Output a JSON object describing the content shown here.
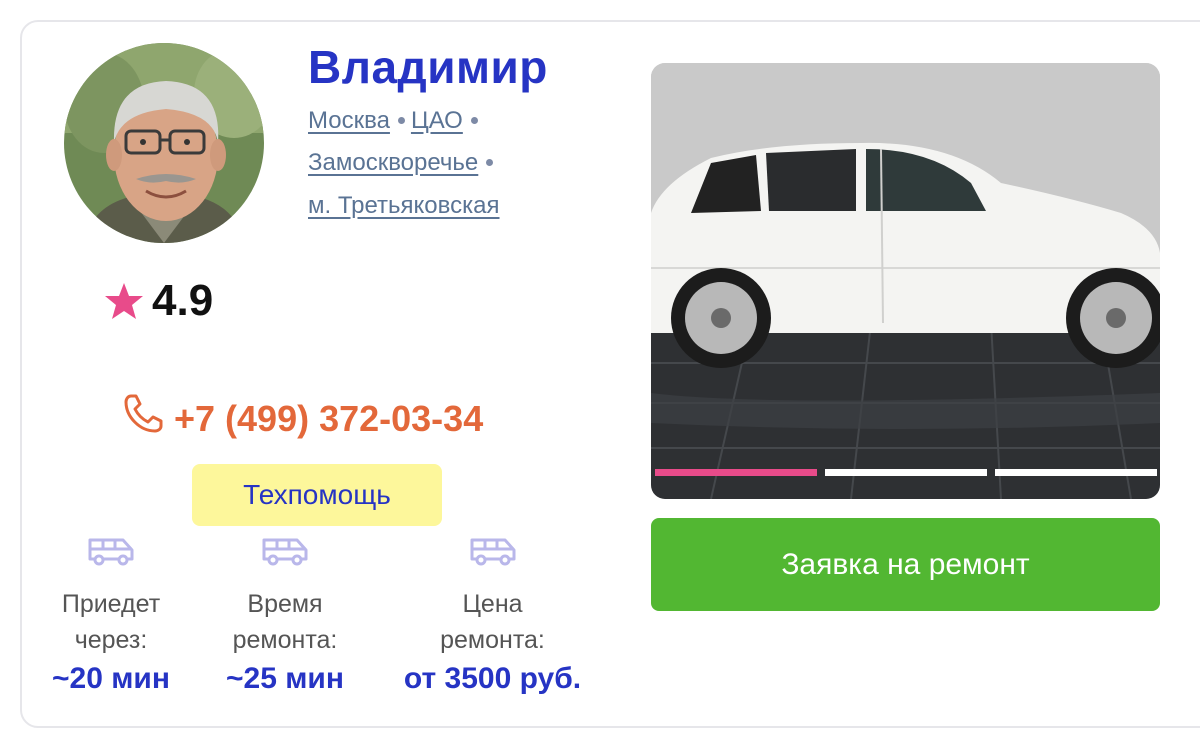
{
  "master": {
    "name": "Владимир",
    "avatar_icon": "person-portrait",
    "rating": "4.9",
    "rating_icon": "star-icon",
    "rating_color": "#e84b8a"
  },
  "location": {
    "city": "Москва",
    "district": "ЦАО",
    "area": "Замоскворечье",
    "metro": "м. Третьяковская"
  },
  "phone": {
    "number": "+7 (499) 372-03-34",
    "icon": "phone-icon",
    "color": "#e3683a"
  },
  "service_tag": "Техпомощь",
  "stats": [
    {
      "icon": "van-icon",
      "label_line1": "Приедет",
      "label_line2": "через:",
      "value": "~20 мин"
    },
    {
      "icon": "van-icon",
      "label_line1": "Время",
      "label_line2": "ремонта:",
      "value": "~25 мин"
    },
    {
      "icon": "van-icon",
      "label_line1": "Цена",
      "label_line2": "ремонта:",
      "value": "от 3500 руб."
    }
  ],
  "gallery": {
    "image_subject": "white-suv-photo",
    "slides_total": 3,
    "active_slide": 1
  },
  "cta": {
    "label": "Заявка на ремонт",
    "color": "#52b732"
  },
  "colors": {
    "accent_blue": "#2634c4",
    "link_gray": "#5a7394",
    "tag_yellow": "#fdf79b"
  }
}
